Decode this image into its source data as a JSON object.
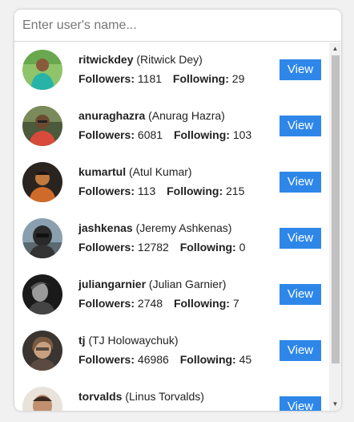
{
  "search": {
    "placeholder": "Enter user's name..."
  },
  "labels": {
    "followers": "Followers:",
    "following": "Following:",
    "view": "View"
  },
  "users": [
    {
      "login": "ritwickdey",
      "name": "(Ritwick Dey)",
      "followers": "1181",
      "following": "29"
    },
    {
      "login": "anuraghazra",
      "name": "(Anurag Hazra)",
      "followers": "6081",
      "following": "103"
    },
    {
      "login": "kumartul",
      "name": "(Atul Kumar)",
      "followers": "113",
      "following": "215"
    },
    {
      "login": "jashkenas",
      "name": "(Jeremy Ashkenas)",
      "followers": "12782",
      "following": "0"
    },
    {
      "login": "juliangarnier",
      "name": "(Julian Garnier)",
      "followers": "2748",
      "following": "7"
    },
    {
      "login": "tj",
      "name": "(TJ Holowaychuk)",
      "followers": "46986",
      "following": "45"
    },
    {
      "login": "torvalds",
      "name": "(Linus Torvalds)",
      "followers": "",
      "following": ""
    }
  ],
  "scrollbar": {
    "up_icon": "triangle-up",
    "down_icon": "triangle-down"
  },
  "colors": {
    "button": "#2e87e8"
  }
}
